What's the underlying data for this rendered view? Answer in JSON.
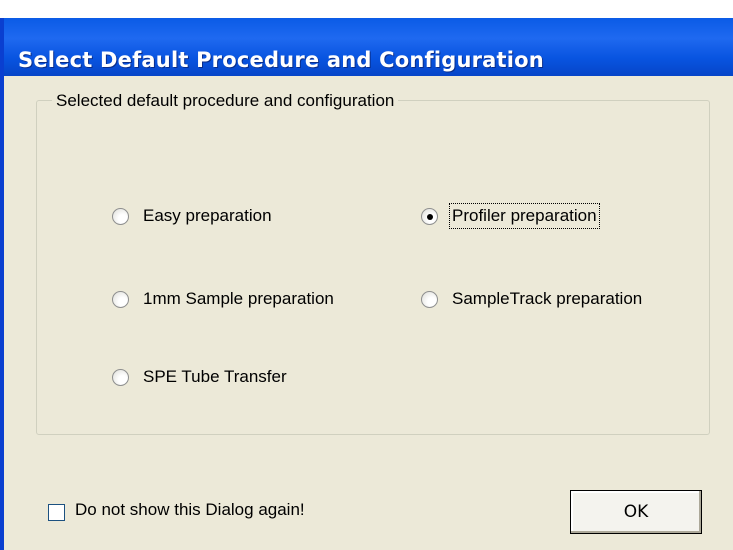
{
  "window": {
    "title": "Select Default Procedure and Configuration"
  },
  "groupbox": {
    "label": "Selected default procedure and configuration",
    "options": [
      {
        "label": "Easy preparation",
        "selected": false
      },
      {
        "label": "Profiler preparation",
        "selected": true
      },
      {
        "label": "1mm Sample preparation",
        "selected": false
      },
      {
        "label": "SampleTrack preparation",
        "selected": false
      },
      {
        "label": "SPE Tube Transfer",
        "selected": false
      }
    ]
  },
  "footer": {
    "checkbox_label": "Do not show this Dialog again!",
    "checkbox_checked": false,
    "ok_label": "OK"
  }
}
